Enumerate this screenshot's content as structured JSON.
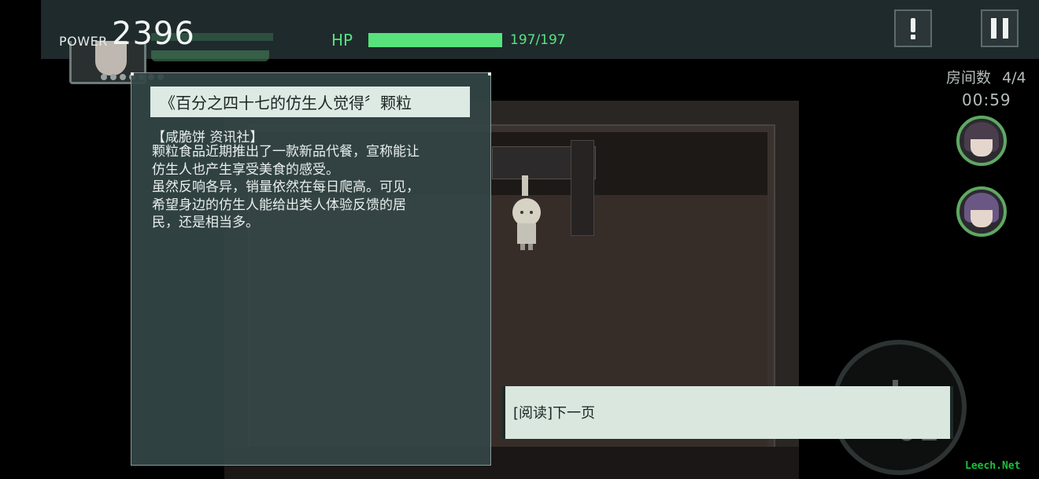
{
  "hud": {
    "power_label": "POWER",
    "power_value": "2396",
    "hp_label": "HP",
    "hp_current": 197,
    "hp_max": 197,
    "hp_text": "197/197",
    "hp_fill_fraction": 1.0,
    "hp_color": "#58e27c",
    "alert_icon": "exclamation-icon",
    "pause_icon": "pause-icon"
  },
  "room": {
    "room_count_label": "房间数",
    "room_count_value": "4/4",
    "timer": "00:59"
  },
  "allies": [
    {
      "name": "ally-portrait-1",
      "icon": "character-portrait"
    },
    {
      "name": "ally-portrait-2",
      "icon": "character-portrait"
    }
  ],
  "document": {
    "title": "《百分之四十七的仿生人觉得〞颗粒",
    "source": "【咸脆饼 资讯社】",
    "body_lines": [
      "颗粒食品近期推出了一款新品代餐，宣称能让",
      "仿生人也产生享受美食的感受。",
      "虽然反响各异，销量依然在每日爬高。可见，",
      "希望身边的仿生人能给出类人体验反馈的居",
      "民，还是相当多。"
    ]
  },
  "prompt": {
    "next_page": "[阅读]下一页"
  },
  "joystick": {
    "number": "01"
  },
  "watermark": "Leech.Net",
  "colors": {
    "hud_bg": "#1f2a2c",
    "panel_bg": "#344647",
    "accent_green": "#5be283",
    "ally_ring": "#5fa862"
  }
}
